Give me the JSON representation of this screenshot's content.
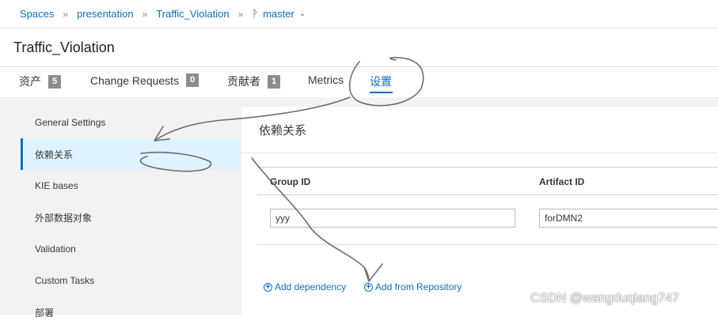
{
  "breadcrumb": {
    "items": [
      "Spaces",
      "presentation",
      "Traffic_Violation"
    ],
    "separator": "»",
    "branch": "master"
  },
  "project": {
    "title": "Traffic_Violation"
  },
  "tabs": [
    {
      "label": "资产",
      "badge": "5"
    },
    {
      "label": "Change Requests",
      "badge": "0"
    },
    {
      "label": "贡献者",
      "badge": "1"
    },
    {
      "label": "Metrics"
    },
    {
      "label": "设置",
      "active": true
    }
  ],
  "sidebar": {
    "items": [
      {
        "label": "General Settings"
      },
      {
        "label": "依赖关系",
        "active": true
      },
      {
        "label": "KIE bases"
      },
      {
        "label": "外部数据对象"
      },
      {
        "label": "Validation"
      },
      {
        "label": "Custom Tasks"
      },
      {
        "label": "部署"
      }
    ]
  },
  "main": {
    "title": "依赖关系",
    "columns": [
      "Group ID",
      "Artifact ID"
    ],
    "row": {
      "group_id": "yyy",
      "artifact_id": "forDMN2"
    },
    "add_dependency": "Add dependency",
    "add_from_repository": "Add from Repository"
  },
  "watermark": "CSDN @wangduqiang747",
  "colors": {
    "accent": "#0f6ebd",
    "badge": "#8b8d8f",
    "active_bg": "#def3ff",
    "annotation": "#555555"
  }
}
